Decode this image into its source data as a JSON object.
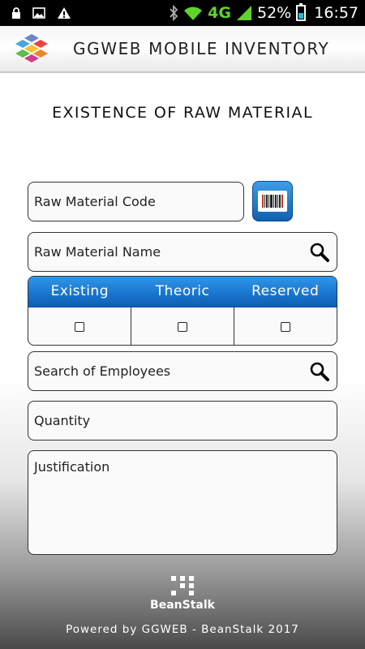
{
  "status_bar": {
    "network": "4G",
    "battery": "52%",
    "time": "16:57",
    "icons": [
      "lock-icon",
      "image-icon",
      "warning-icon",
      "bluetooth-icon",
      "wifi-icon",
      "signal-icon",
      "battery-icon"
    ]
  },
  "header": {
    "title": "GGWEB MOBILE INVENTORY",
    "logo_icon": "cube-logo-icon"
  },
  "page": {
    "title": "EXISTENCE OF RAW MATERIAL"
  },
  "form": {
    "raw_material_code": {
      "placeholder": "Raw Material Code"
    },
    "raw_material_name": {
      "placeholder": "Raw Material Name"
    },
    "stock_table": {
      "columns": [
        "Existing",
        "Theoric",
        "Reserved"
      ],
      "values": [
        "",
        "",
        ""
      ]
    },
    "employee_search": {
      "placeholder": "Search of Employees"
    },
    "quantity": {
      "placeholder": "Quantity"
    },
    "justification": {
      "placeholder": "Justification"
    }
  },
  "footer": {
    "brand": "BeanStalk",
    "powered_by": "Powered by GGWEB - BeanStalk 2017"
  },
  "colors": {
    "accent": "#1a76cf",
    "status_bar": "#000000",
    "network": "#5fd32a"
  }
}
